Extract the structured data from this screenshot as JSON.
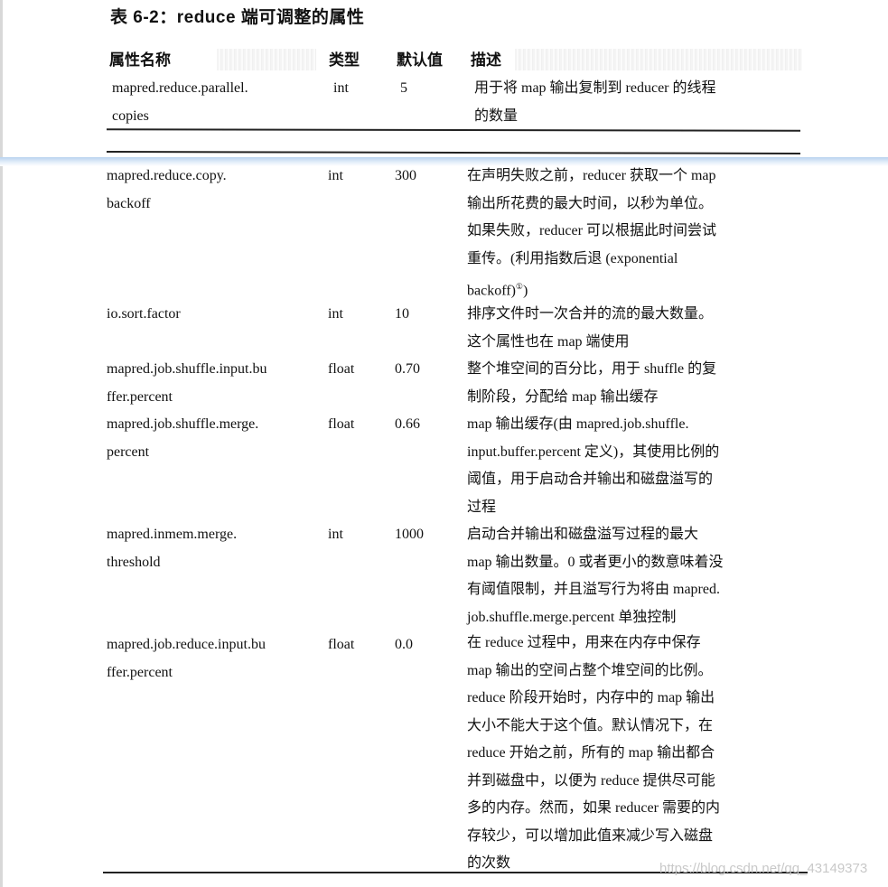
{
  "title": "表 6-2：reduce 端可调整的属性",
  "headers": {
    "name": "属性名称",
    "type": "类型",
    "default": "默认值",
    "desc": "描述"
  },
  "rows": [
    {
      "name_lines": [
        "mapred.reduce.parallel.",
        "copies"
      ],
      "type": "int",
      "default": "5",
      "desc_lines": [
        "用于将 map 输出复制到 reducer 的线程",
        "的数量"
      ]
    },
    {
      "name_lines": [
        "mapred.reduce.copy.",
        "backoff"
      ],
      "type": "int",
      "default": "300",
      "desc_lines": [
        "在声明失败之前，reducer 获取一个 map",
        "输出所花费的最大时间，以秒为单位。",
        "如果失败，reducer 可以根据此时间尝试",
        "重传。(利用指数后退 (exponential",
        "backoff)"
      ],
      "footnote_mark": "①",
      "desc_tail": ")"
    },
    {
      "name_lines": [
        "io.sort.factor"
      ],
      "type": "int",
      "default": "10",
      "desc_lines": [
        "排序文件时一次合并的流的最大数量。",
        "这个属性也在 map 端使用"
      ]
    },
    {
      "name_lines": [
        "mapred.job.shuffle.input.bu",
        "ffer.percent"
      ],
      "type": "float",
      "default": "0.70",
      "desc_lines": [
        "整个堆空间的百分比，用于 shuffle 的复",
        "制阶段，分配给 map 输出缓存"
      ]
    },
    {
      "name_lines": [
        "mapred.job.shuffle.merge.",
        "percent"
      ],
      "type": "float",
      "default": "0.66",
      "desc_lines": [
        "map 输出缓存(由 mapred.job.shuffle.",
        "input.buffer.percent 定义)，其使用比例的",
        "阈值，用于启动合并输出和磁盘溢写的",
        "过程"
      ]
    },
    {
      "name_lines": [
        "mapred.inmem.merge.",
        "threshold"
      ],
      "type": "int",
      "default": "1000",
      "desc_lines": [
        "启动合并输出和磁盘溢写过程的最大",
        "map 输出数量。0 或者更小的数意味着没",
        "有阈值限制，并且溢写行为将由 mapred.",
        "job.shuffle.merge.percent 单独控制"
      ]
    },
    {
      "name_lines": [
        "mapred.job.reduce.input.bu",
        "ffer.percent"
      ],
      "type": "float",
      "default": "0.0",
      "desc_lines": [
        "在 reduce 过程中，用来在内存中保存",
        "map 输出的空间占整个堆空间的比例。",
        "reduce 阶段开始时，内存中的 map 输出",
        "大小不能大于这个值。默认情况下，在",
        "reduce 开始之前，所有的 map 输出都合",
        "并到磁盘中，以便为 reduce 提供尽可能",
        "多的内存。然而，如果 reducer 需要的内",
        "存较少，可以增加此值来减少写入磁盘",
        "的次数"
      ]
    }
  ],
  "watermark": "https://blog.csdn.net/qq_43149373"
}
